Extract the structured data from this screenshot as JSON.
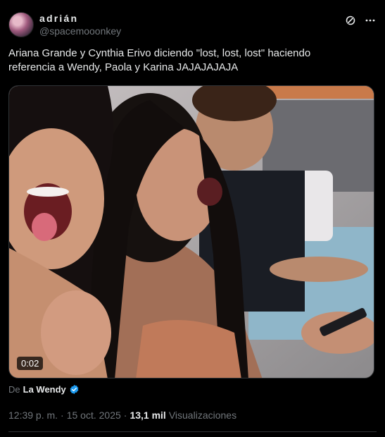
{
  "author": {
    "display_name": "adrián",
    "handle": "@spacemooonkey"
  },
  "icons": {
    "grok": "grok-icon",
    "more": "more-options-icon",
    "verified": "verified-badge-icon"
  },
  "tweet": {
    "text": "Ariana Grande y Cynthia Erivo diciendo \"lost, lost, lost\" haciendo referencia a Wendy, Paola y Karina JAJAJAJAJA"
  },
  "video": {
    "duration": "0:02"
  },
  "source": {
    "prefix": "De",
    "name": "La Wendy"
  },
  "meta": {
    "time": "12:39 p. m.",
    "separator1": "·",
    "date": "15 oct. 2025",
    "separator2": "·",
    "views_count": "13,1 mil",
    "views_label": "Visualizaciones"
  },
  "colors": {
    "background": "#000000",
    "text": "#e7e9ea",
    "muted": "#71767b",
    "verified": "#1d9bf0",
    "border": "#2f3336"
  }
}
